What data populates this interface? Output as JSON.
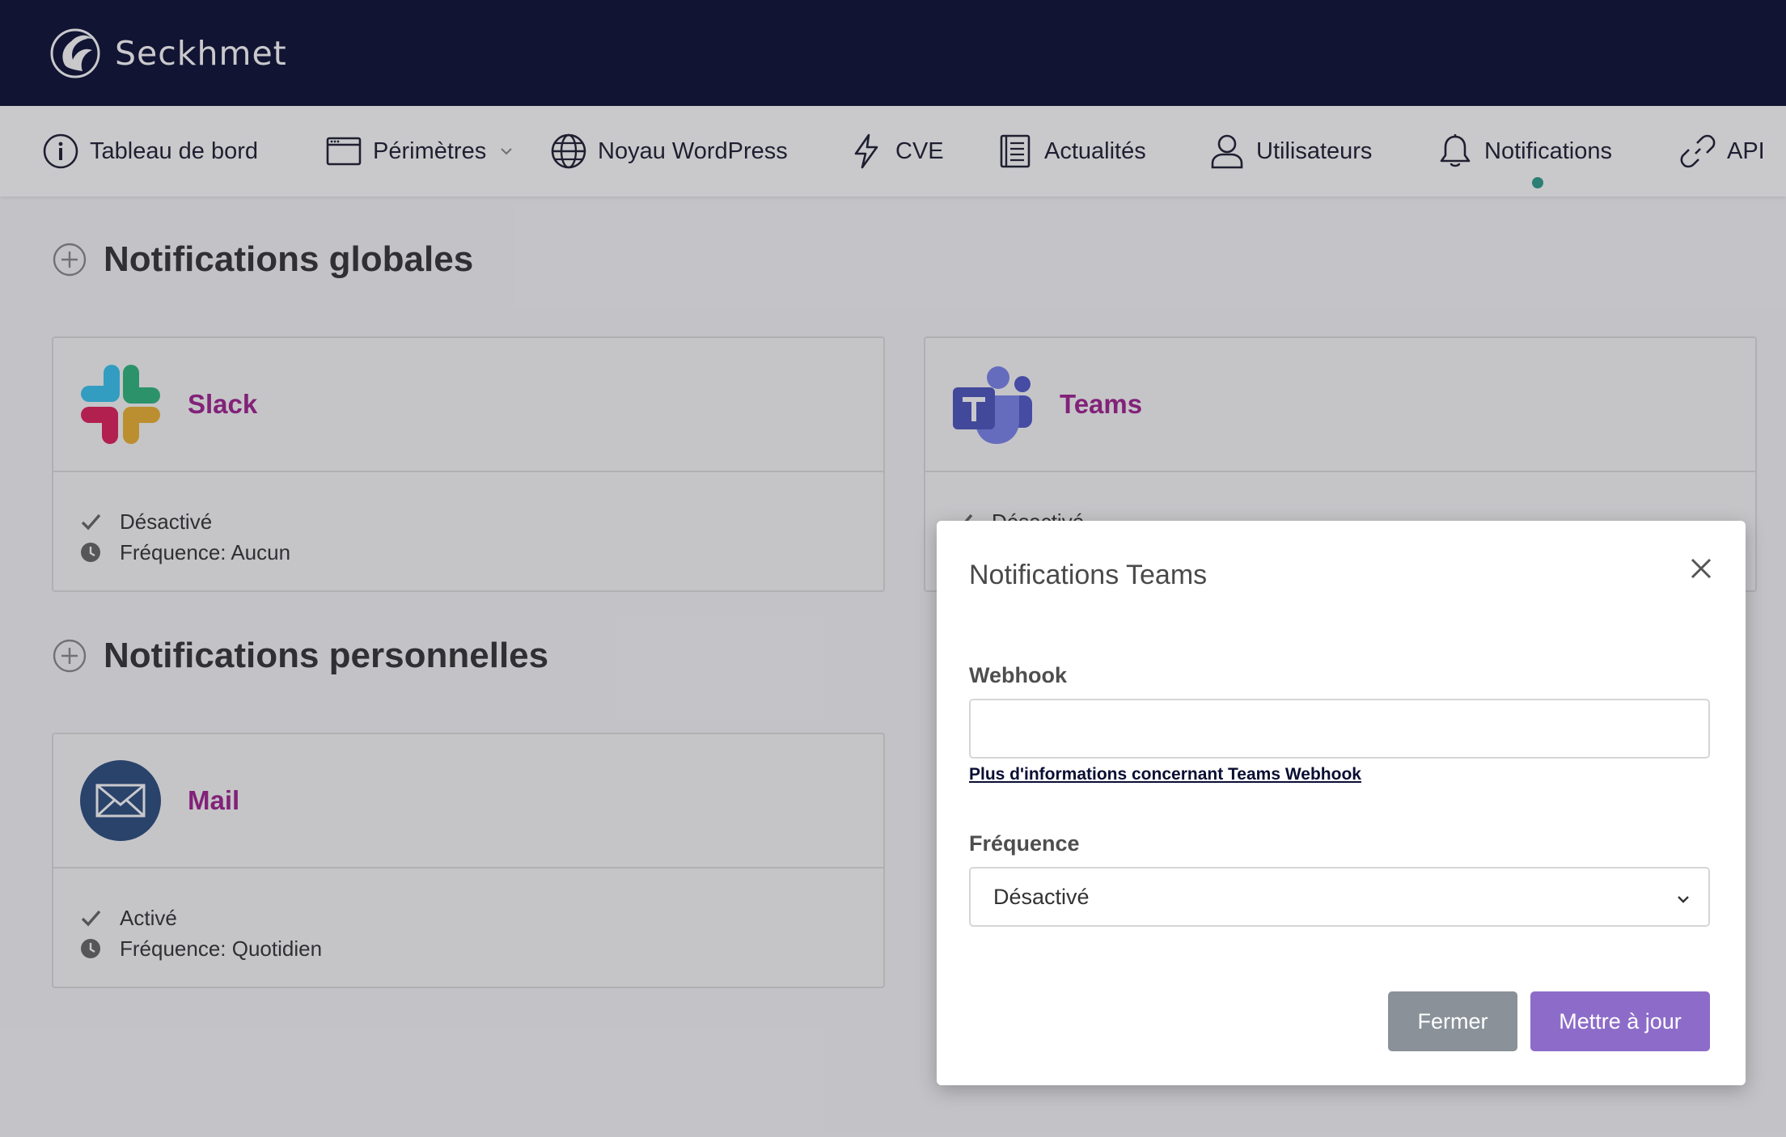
{
  "brand": {
    "name": "Seckhmet"
  },
  "nav": {
    "items": [
      {
        "label": "Tableau de bord",
        "icon": "info-circle-icon"
      },
      {
        "label": "Périmètres",
        "icon": "browser-window-icon"
      },
      {
        "label": "Noyau WordPress",
        "icon": "globe-icon"
      },
      {
        "label": "CVE",
        "icon": "lightning-icon"
      },
      {
        "label": "Actualités",
        "icon": "book-icon"
      },
      {
        "label": "Utilisateurs",
        "icon": "user-icon"
      },
      {
        "label": "Notifications",
        "icon": "bell-icon"
      },
      {
        "label": "API",
        "icon": "link-icon"
      }
    ],
    "active": "Notifications"
  },
  "global_section": {
    "title": "Notifications globales",
    "cards": [
      {
        "name": "Slack",
        "status": "Désactivé",
        "frequency": "Fréquence: Aucun"
      },
      {
        "name": "Teams",
        "status": "Désactivé"
      }
    ]
  },
  "personal_section": {
    "title": "Notifications personnelles",
    "cards": [
      {
        "name": "Mail",
        "status": "Activé",
        "frequency": "Fréquence: Quotidien"
      }
    ]
  },
  "modal": {
    "title": "Notifications Teams",
    "webhook_label": "Webhook",
    "webhook_value": "",
    "help_link": "Plus d'informations concernant Teams Webhook",
    "frequency_label": "Fréquence",
    "frequency_value": "Désactivé",
    "close_button": "Fermer",
    "update_button": "Mettre à jour"
  },
  "colors": {
    "header_bg": "#0a0e33",
    "accent_name": "#a0208f",
    "active_dot": "#2f9c8a",
    "primary_button": "#8d6cc9",
    "secondary_button": "#8a9199"
  }
}
